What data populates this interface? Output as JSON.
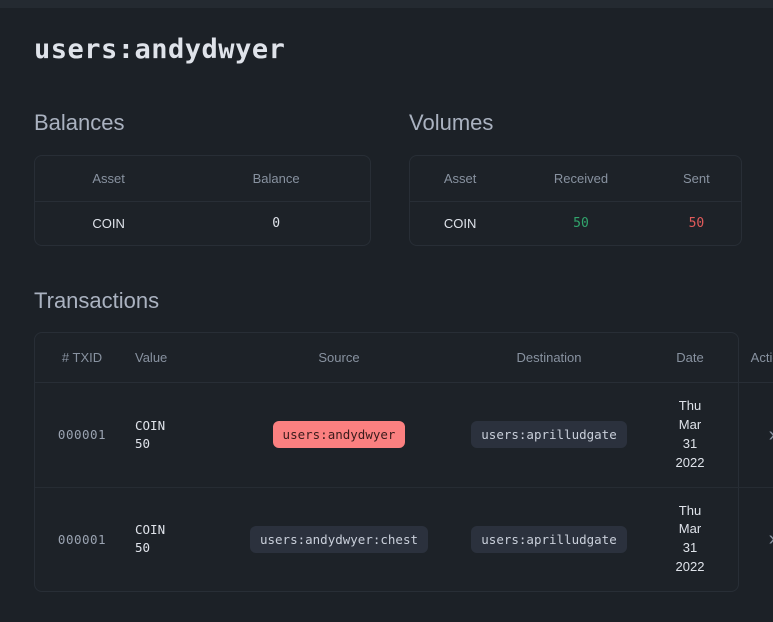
{
  "page": {
    "title": "users:andydwyer"
  },
  "balances": {
    "heading": "Balances",
    "columns": [
      "Asset",
      "Balance"
    ],
    "rows": [
      {
        "asset": "COIN",
        "balance": "0"
      }
    ]
  },
  "volumes": {
    "heading": "Volumes",
    "columns": [
      "Asset",
      "Received",
      "Sent"
    ],
    "rows": [
      {
        "asset": "COIN",
        "received": "50",
        "sent": "50"
      }
    ],
    "received_color": "#31a46c",
    "sent_color": "#e05a5a"
  },
  "transactions": {
    "heading": "Transactions",
    "columns": [
      "# TXID",
      "Value",
      "Source",
      "Destination",
      "Date",
      "Actions"
    ],
    "rows": [
      {
        "txid": "000001",
        "value_asset": "COIN",
        "value_amount": "50",
        "source": "users:andydwyer",
        "source_style": "highlight",
        "destination": "users:aprilludgate",
        "date_line1": "Thu",
        "date_line2": "Mar",
        "date_line3": "31",
        "date_line4": "2022",
        "action_icon": "chevron-right-icon"
      },
      {
        "txid": "000001",
        "value_asset": "COIN",
        "value_amount": "50",
        "source": "users:andydwyer:chest",
        "source_style": "normal",
        "destination": "users:aprilludgate",
        "date_line1": "Thu",
        "date_line2": "Mar",
        "date_line3": "31",
        "date_line4": "2022",
        "action_icon": "chevron-right-icon"
      }
    ],
    "chevron_glyph": "›",
    "highlight_color": "#fb8080"
  }
}
